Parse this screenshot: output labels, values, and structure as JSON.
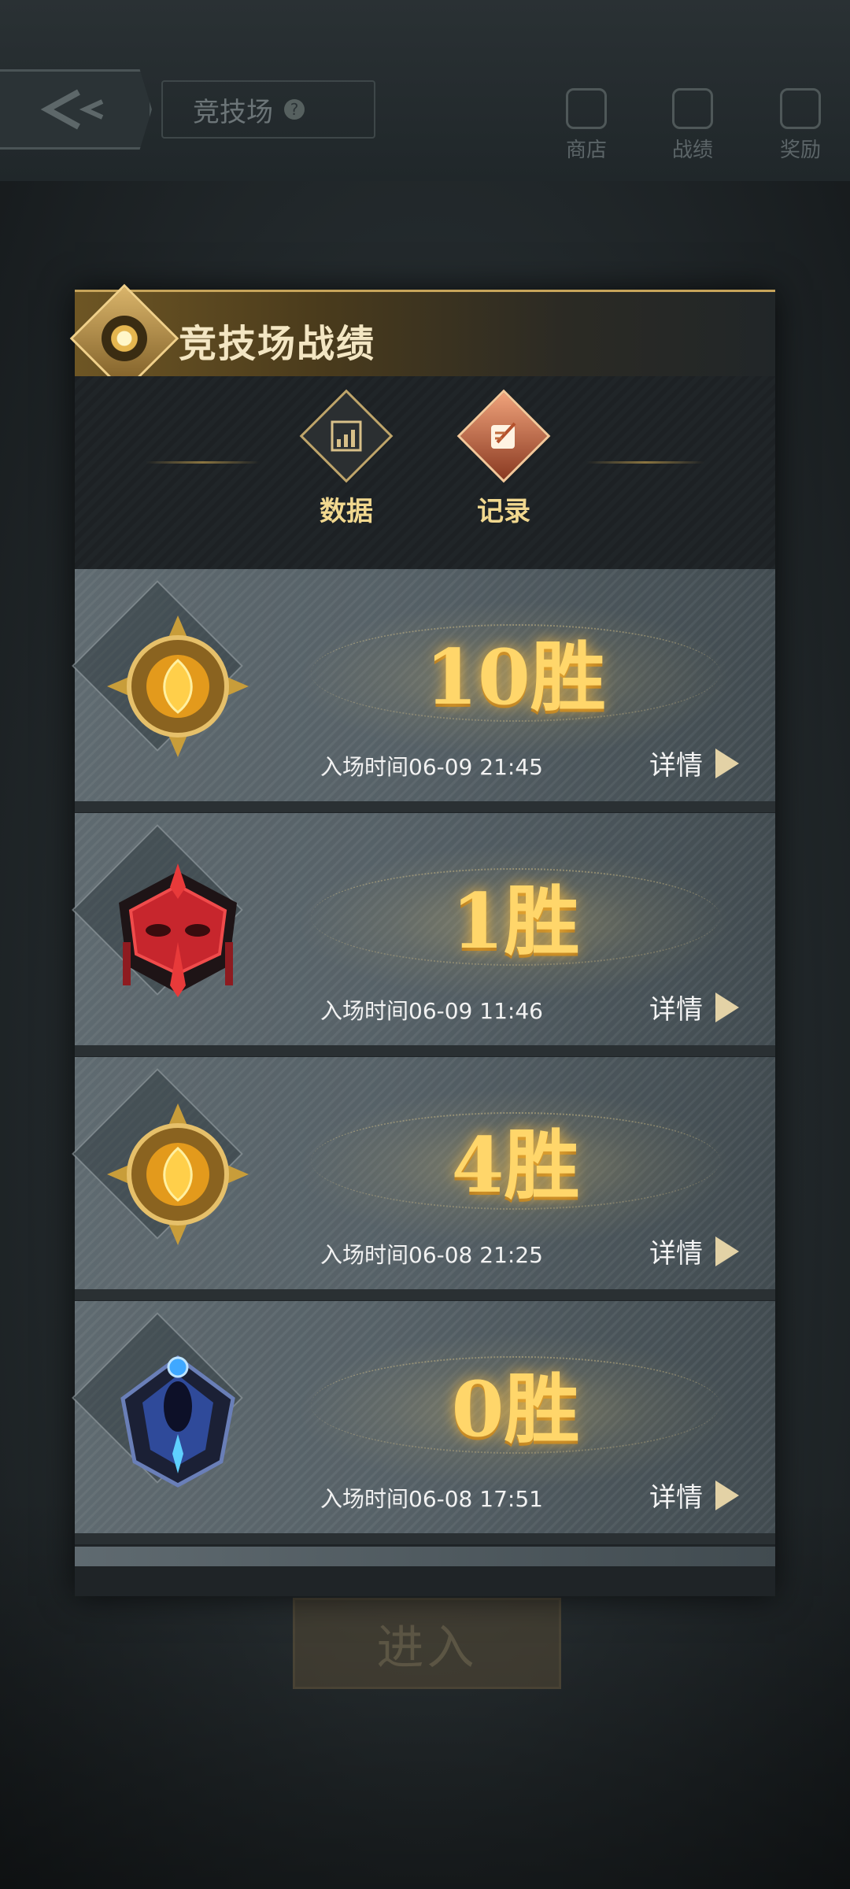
{
  "background": {
    "title": "竞技场",
    "help": "?",
    "nav": [
      {
        "label": "商店",
        "icon": "shop-icon"
      },
      {
        "label": "战绩",
        "icon": "shield-icon"
      },
      {
        "label": "奖励",
        "icon": "gift-icon"
      }
    ],
    "enter_label": "进入"
  },
  "panel": {
    "title": "竞技场战绩",
    "tabs": [
      {
        "label": "数据",
        "icon": "chart-icon",
        "active": false
      },
      {
        "label": "记录",
        "icon": "scroll-quill-icon",
        "active": true
      }
    ],
    "records": [
      {
        "wins": "10胜",
        "entry_time": "入场时间06-09 21:45",
        "detail_label": "详情",
        "medal": "gold-medal-icon"
      },
      {
        "wins": "1胜",
        "entry_time": "入场时间06-09 11:46",
        "detail_label": "详情",
        "medal": "red-mask-medal-icon"
      },
      {
        "wins": "4胜",
        "entry_time": "入场时间06-08 21:25",
        "detail_label": "详情",
        "medal": "gold-medal-icon"
      },
      {
        "wins": "0胜",
        "entry_time": "入场时间06-08 17:51",
        "detail_label": "详情",
        "medal": "blue-helmet-medal-icon"
      }
    ]
  },
  "colors": {
    "accent_gold": "#ffd66a",
    "header_gold": "#c7a45a",
    "tab_label": "#f1d88f"
  }
}
